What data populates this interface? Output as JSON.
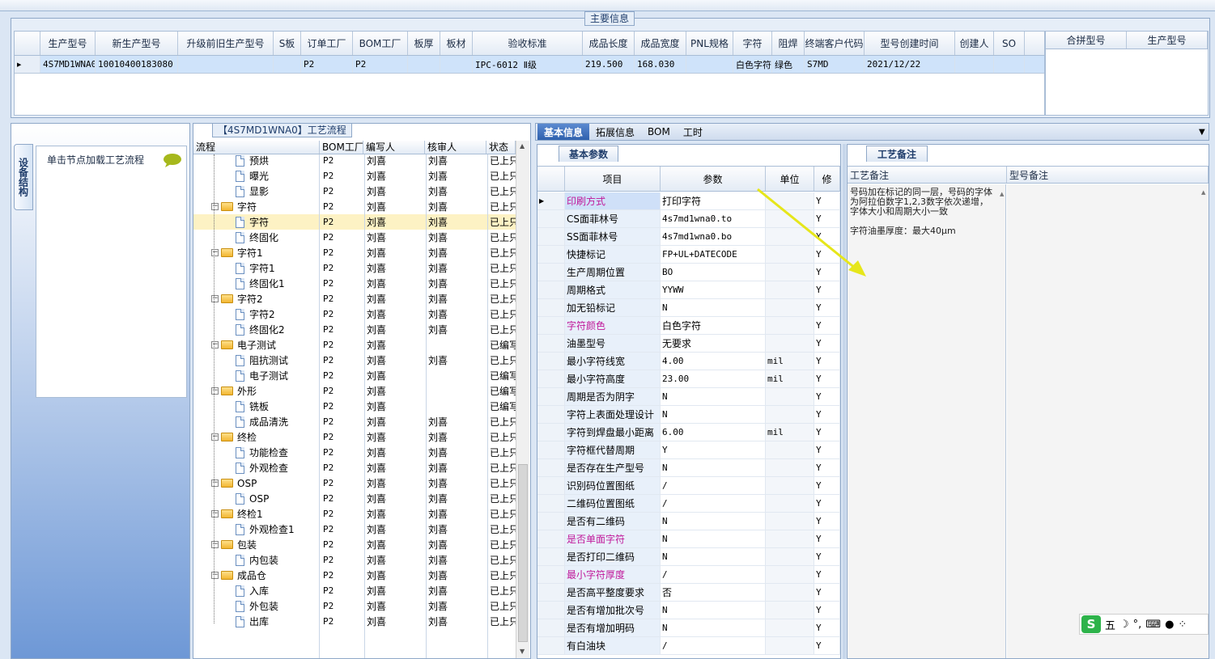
{
  "main": {
    "title": "主要信息",
    "columns": [
      "生产型号",
      "新生产型号",
      "升级前旧生产型号",
      "S板",
      "订单工厂",
      "BOM工厂",
      "板厚",
      "板材",
      "验收标准",
      "成品长度",
      "成品宽度",
      "PNL规格",
      "字符",
      "阻焊",
      "终端客户代码",
      "型号创建时间",
      "创建人",
      "SO"
    ],
    "row": [
      "4S7MD1WNA0",
      "10010400183080",
      "",
      "",
      "P2",
      "P2",
      "",
      "",
      "IPC-6012 Ⅱ级",
      "219.500",
      "168.030",
      "",
      "白色字符",
      "绿色",
      "S7MD",
      "2021/12/22",
      "",
      ""
    ],
    "merge_columns": [
      "合拼型号",
      "生产型号"
    ]
  },
  "left": {
    "tab_label": "设备结构",
    "node_hint": "单击节点加载工艺流程"
  },
  "tree": {
    "title": "【4S7MD1WNA0】工艺流程",
    "columns": [
      "流程",
      "BOM工厂",
      "编写人",
      "核审人",
      "状态"
    ],
    "rows": [
      {
        "name": "预烘",
        "bom": "P2",
        "writer": "刘喜",
        "reviewer": "刘喜",
        "status": "已上只"
      },
      {
        "name": "曝光",
        "bom": "P2",
        "writer": "刘喜",
        "reviewer": "刘喜",
        "status": "已上只"
      },
      {
        "name": "显影",
        "bom": "P2",
        "writer": "刘喜",
        "reviewer": "刘喜",
        "status": "已上只"
      },
      {
        "name": "字符",
        "bom": "P2",
        "writer": "刘喜",
        "reviewer": "刘喜",
        "status": "已上只"
      },
      {
        "name": "字符",
        "bom": "P2",
        "writer": "刘喜",
        "reviewer": "刘喜",
        "status": "已上只"
      },
      {
        "name": "终固化",
        "bom": "P2",
        "writer": "刘喜",
        "reviewer": "刘喜",
        "status": "已上只"
      },
      {
        "name": "字符1",
        "bom": "P2",
        "writer": "刘喜",
        "reviewer": "刘喜",
        "status": "已上只"
      },
      {
        "name": "字符1",
        "bom": "P2",
        "writer": "刘喜",
        "reviewer": "刘喜",
        "status": "已上只"
      },
      {
        "name": "终固化1",
        "bom": "P2",
        "writer": "刘喜",
        "reviewer": "刘喜",
        "status": "已上只"
      },
      {
        "name": "字符2",
        "bom": "P2",
        "writer": "刘喜",
        "reviewer": "刘喜",
        "status": "已上只"
      },
      {
        "name": "字符2",
        "bom": "P2",
        "writer": "刘喜",
        "reviewer": "刘喜",
        "status": "已上只"
      },
      {
        "name": "终固化2",
        "bom": "P2",
        "writer": "刘喜",
        "reviewer": "刘喜",
        "status": "已上只"
      },
      {
        "name": "电子测试",
        "bom": "P2",
        "writer": "刘喜",
        "reviewer": "",
        "status": "已编写"
      },
      {
        "name": "阻抗测试",
        "bom": "P2",
        "writer": "刘喜",
        "reviewer": "刘喜",
        "status": "已上只"
      },
      {
        "name": "电子测试",
        "bom": "P2",
        "writer": "刘喜",
        "reviewer": "",
        "status": "已编写"
      },
      {
        "name": "外形",
        "bom": "P2",
        "writer": "刘喜",
        "reviewer": "",
        "status": "已编写"
      },
      {
        "name": "铣板",
        "bom": "P2",
        "writer": "刘喜",
        "reviewer": "",
        "status": "已编写"
      },
      {
        "name": "成品清洗",
        "bom": "P2",
        "writer": "刘喜",
        "reviewer": "刘喜",
        "status": "已上只"
      },
      {
        "name": "终检",
        "bom": "P2",
        "writer": "刘喜",
        "reviewer": "刘喜",
        "status": "已上只"
      },
      {
        "name": "功能检查",
        "bom": "P2",
        "writer": "刘喜",
        "reviewer": "刘喜",
        "status": "已上只"
      },
      {
        "name": "外观检查",
        "bom": "P2",
        "writer": "刘喜",
        "reviewer": "刘喜",
        "status": "已上只"
      },
      {
        "name": "OSP",
        "bom": "P2",
        "writer": "刘喜",
        "reviewer": "刘喜",
        "status": "已上只"
      },
      {
        "name": "OSP",
        "bom": "P2",
        "writer": "刘喜",
        "reviewer": "刘喜",
        "status": "已上只"
      },
      {
        "name": "终检1",
        "bom": "P2",
        "writer": "刘喜",
        "reviewer": "刘喜",
        "status": "已上只"
      },
      {
        "name": "外观检查1",
        "bom": "P2",
        "writer": "刘喜",
        "reviewer": "刘喜",
        "status": "已上只"
      },
      {
        "name": "包装",
        "bom": "P2",
        "writer": "刘喜",
        "reviewer": "刘喜",
        "status": "已上只"
      },
      {
        "name": "内包装",
        "bom": "P2",
        "writer": "刘喜",
        "reviewer": "刘喜",
        "status": "已上只"
      },
      {
        "name": "成品仓",
        "bom": "P2",
        "writer": "刘喜",
        "reviewer": "刘喜",
        "status": "已上只"
      },
      {
        "name": "入库",
        "bom": "P2",
        "writer": "刘喜",
        "reviewer": "刘喜",
        "status": "已上只"
      },
      {
        "name": "外包装",
        "bom": "P2",
        "writer": "刘喜",
        "reviewer": "刘喜",
        "status": "已上只"
      },
      {
        "name": "出库",
        "bom": "P2",
        "writer": "刘喜",
        "reviewer": "刘喜",
        "status": "已上只"
      }
    ]
  },
  "tabs": [
    "基本信息",
    "拓展信息",
    "BOM",
    "工时"
  ],
  "basic": {
    "title": "基本参数",
    "columns": [
      "项目",
      "参数",
      "单位",
      "修"
    ],
    "rows": [
      {
        "item": "印刷方式",
        "value": "打印字符",
        "unit": "",
        "mod": "Y",
        "pink": true
      },
      {
        "item": "CS面菲林号",
        "value": "4s7md1wna0.to",
        "unit": "",
        "mod": "Y",
        "pink": false
      },
      {
        "item": "SS面菲林号",
        "value": "4s7md1wna0.bo",
        "unit": "",
        "mod": "Y",
        "pink": false
      },
      {
        "item": "快捷标记",
        "value": "FP+UL+DATECODE",
        "unit": "",
        "mod": "Y",
        "pink": false
      },
      {
        "item": "生产周期位置",
        "value": "BO",
        "unit": "",
        "mod": "Y",
        "pink": false
      },
      {
        "item": "周期格式",
        "value": "YYWW",
        "unit": "",
        "mod": "Y",
        "pink": false
      },
      {
        "item": "加无铅标记",
        "value": "N",
        "unit": "",
        "mod": "Y",
        "pink": false
      },
      {
        "item": "字符颜色",
        "value": "白色字符",
        "unit": "",
        "mod": "Y",
        "pink": true
      },
      {
        "item": "油墨型号",
        "value": "无要求",
        "unit": "",
        "mod": "Y",
        "pink": false
      },
      {
        "item": "最小字符线宽",
        "value": "4.00",
        "unit": "mil",
        "mod": "Y",
        "pink": false
      },
      {
        "item": "最小字符高度",
        "value": "23.00",
        "unit": "mil",
        "mod": "Y",
        "pink": false
      },
      {
        "item": "周期是否为阴字",
        "value": "N",
        "unit": "",
        "mod": "Y",
        "pink": false
      },
      {
        "item": "字符上表面处理设计",
        "value": "N",
        "unit": "",
        "mod": "Y",
        "pink": false
      },
      {
        "item": "字符到焊盘最小距离",
        "value": "6.00",
        "unit": "mil",
        "mod": "Y",
        "pink": false
      },
      {
        "item": "字符框代替周期",
        "value": "Y",
        "unit": "",
        "mod": "Y",
        "pink": false
      },
      {
        "item": "是否存在生产型号",
        "value": "N",
        "unit": "",
        "mod": "Y",
        "pink": false
      },
      {
        "item": "识别码位置图纸",
        "value": "/",
        "unit": "",
        "mod": "Y",
        "pink": false
      },
      {
        "item": "二维码位置图纸",
        "value": "/",
        "unit": "",
        "mod": "Y",
        "pink": false
      },
      {
        "item": "是否有二维码",
        "value": "N",
        "unit": "",
        "mod": "Y",
        "pink": false
      },
      {
        "item": "是否单面字符",
        "value": "N",
        "unit": "",
        "mod": "Y",
        "pink": true
      },
      {
        "item": "是否打印二维码",
        "value": "N",
        "unit": "",
        "mod": "Y",
        "pink": false
      },
      {
        "item": "最小字符厚度",
        "value": "/",
        "unit": "",
        "mod": "Y",
        "pink": true
      },
      {
        "item": "是否高平整度要求",
        "value": "否",
        "unit": "",
        "mod": "Y",
        "pink": false
      },
      {
        "item": "是否有增加批次号",
        "value": "N",
        "unit": "",
        "mod": "Y",
        "pink": false
      },
      {
        "item": "是否有增加明码",
        "value": "N",
        "unit": "",
        "mod": "Y",
        "pink": false
      },
      {
        "item": "有白油块",
        "value": "/",
        "unit": "",
        "mod": "Y",
        "pink": false
      }
    ]
  },
  "notes": {
    "title": "工艺备注",
    "process_label": "工艺备注",
    "model_label": "型号备注",
    "process_text_1": "号码加在标记的同一层，号码的字体为阿拉伯数字1,2,3数字依次递增，字体大小和周期大小一致",
    "process_text_2": "字符油墨厚度：最大40μm"
  },
  "ime": {
    "logo": "S",
    "mode": "五"
  },
  "colors": {
    "accent": "#2f61ae",
    "pink": "#c0189a",
    "selected_row": "#fdf2c4",
    "arrow": "#e6e61a"
  }
}
